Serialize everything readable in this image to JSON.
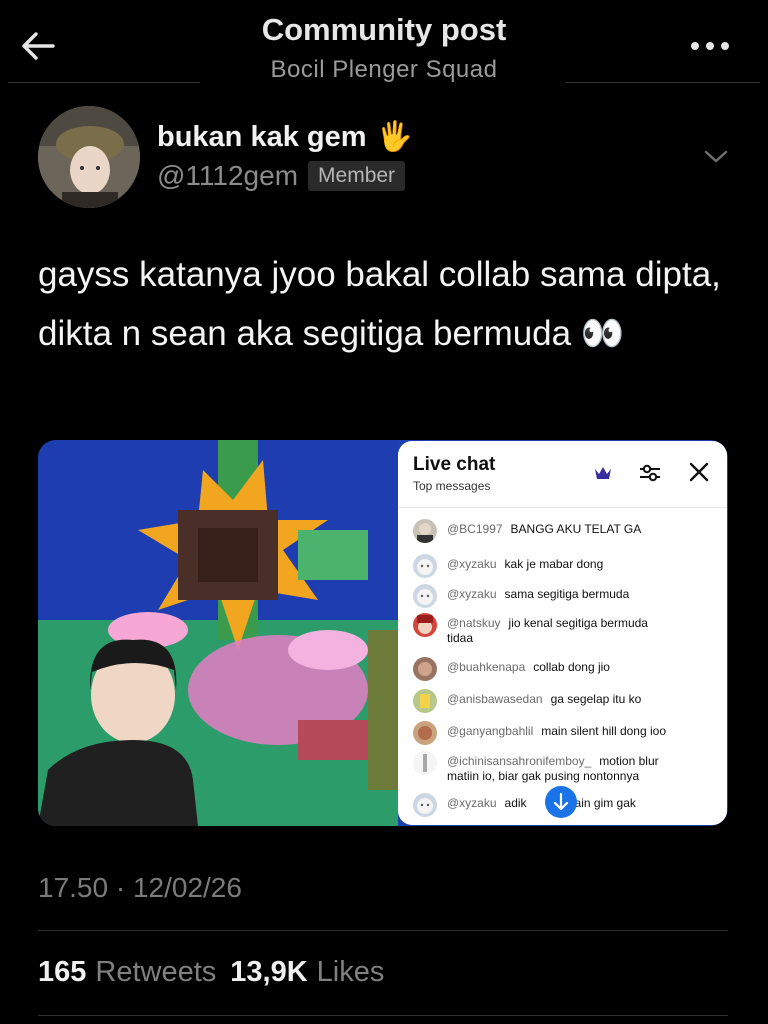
{
  "header": {
    "title": "Community post",
    "subtitle": "Bocil Plenger Squad",
    "back_icon": "arrow-left-icon",
    "more_icon": "more-horizontal-icon"
  },
  "author": {
    "name": "bukan kak gem",
    "emoji": "🖐",
    "handle": "@1112gem",
    "badge": "Member"
  },
  "post": {
    "text": "gayss katanya jyoo bakal collab sama dipta, dikta n sean aka segitiga bermuda 👀"
  },
  "media": {
    "livechat": {
      "title": "Live chat",
      "subtitle": "Top messages",
      "messages": [
        {
          "user": "@BC1997",
          "text": "BANGG AKU TELAT GA",
          "cont": ""
        },
        {
          "user": "@xyzaku",
          "text": "kak je mabar dong",
          "cont": ""
        },
        {
          "user": "@xyzaku",
          "text": "sama segitiga bermuda",
          "cont": ""
        },
        {
          "user": "@natskuy",
          "text": "jio kenal segitiga bermuda",
          "cont": "tidaa"
        },
        {
          "user": "@buahkenapa",
          "text": "collab dong jio",
          "cont": ""
        },
        {
          "user": "@anisbawasedan",
          "text": "ga segelap itu ko",
          "cont": ""
        },
        {
          "user": "@ganyangbahlil",
          "text": "main silent hill dong ioo",
          "cont": ""
        },
        {
          "user": "@ichinisansahronifemboy_",
          "text": "motion blur",
          "cont": "matiin io, biar gak pusing nontonnya"
        },
        {
          "user": "@xyzaku",
          "text": "adik",
          "cont": "",
          "tail": "main gim gak"
        }
      ]
    }
  },
  "footer": {
    "timestamp": "17.50 · 12/02/26",
    "retweets_count": "165",
    "retweets_label": "Retweets",
    "likes_count": "13,9K",
    "likes_label": "Likes"
  },
  "colors": {
    "background": "#000000",
    "text": "#f4f4f4",
    "muted": "#808080",
    "accent": "#1a73e8"
  }
}
